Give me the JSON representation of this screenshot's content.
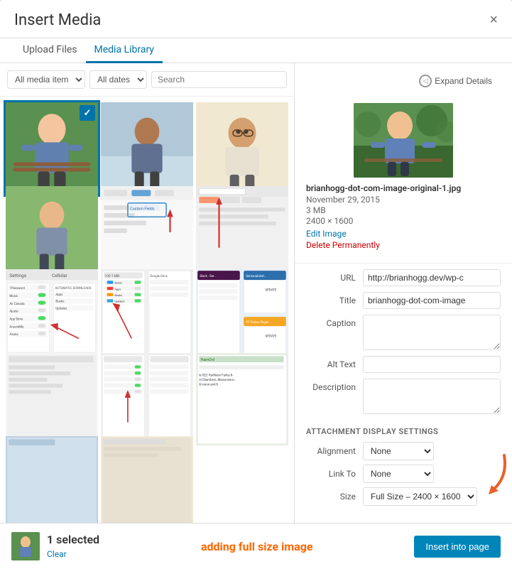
{
  "modal": {
    "title": "Insert Media",
    "close_label": "×"
  },
  "tabs": [
    {
      "id": "upload",
      "label": "Upload Files",
      "active": false
    },
    {
      "id": "library",
      "label": "Media Library",
      "active": true
    }
  ],
  "expand_btn": {
    "label": "Expand Details"
  },
  "filters": {
    "media_type": {
      "label": "All media item",
      "options": [
        "All media items"
      ]
    },
    "date": {
      "label": "All dates",
      "options": [
        "All dates"
      ]
    },
    "search_placeholder": "Search"
  },
  "selected_media": {
    "filename": "brianhogg-dot-com-image-original-1.jpg",
    "date": "November 29, 2015",
    "size": "3 MB",
    "dimensions": "2400 × 1600",
    "edit_label": "Edit Image",
    "delete_label": "Delete Permanently",
    "url": "http://brianhogg.dev/wp-c",
    "title": "brianhogg-dot-com-image",
    "caption": "",
    "alt_text": "",
    "description": ""
  },
  "form_labels": {
    "url": "URL",
    "title": "Title",
    "caption": "Caption",
    "alt_text": "Alt Text",
    "description": "Description"
  },
  "attachment_settings": {
    "section_title": "ATTACHMENT DISPLAY SETTINGS",
    "alignment_label": "Alignment",
    "alignment_value": "None",
    "link_to_label": "Link To",
    "link_to_value": "None",
    "size_label": "Size",
    "size_value": "Full Size – 2400 × 1600"
  },
  "footer": {
    "selected_count": "1 selected",
    "clear_label": "Clear",
    "annotation": "adding full size image",
    "insert_label": "Insert into page"
  }
}
